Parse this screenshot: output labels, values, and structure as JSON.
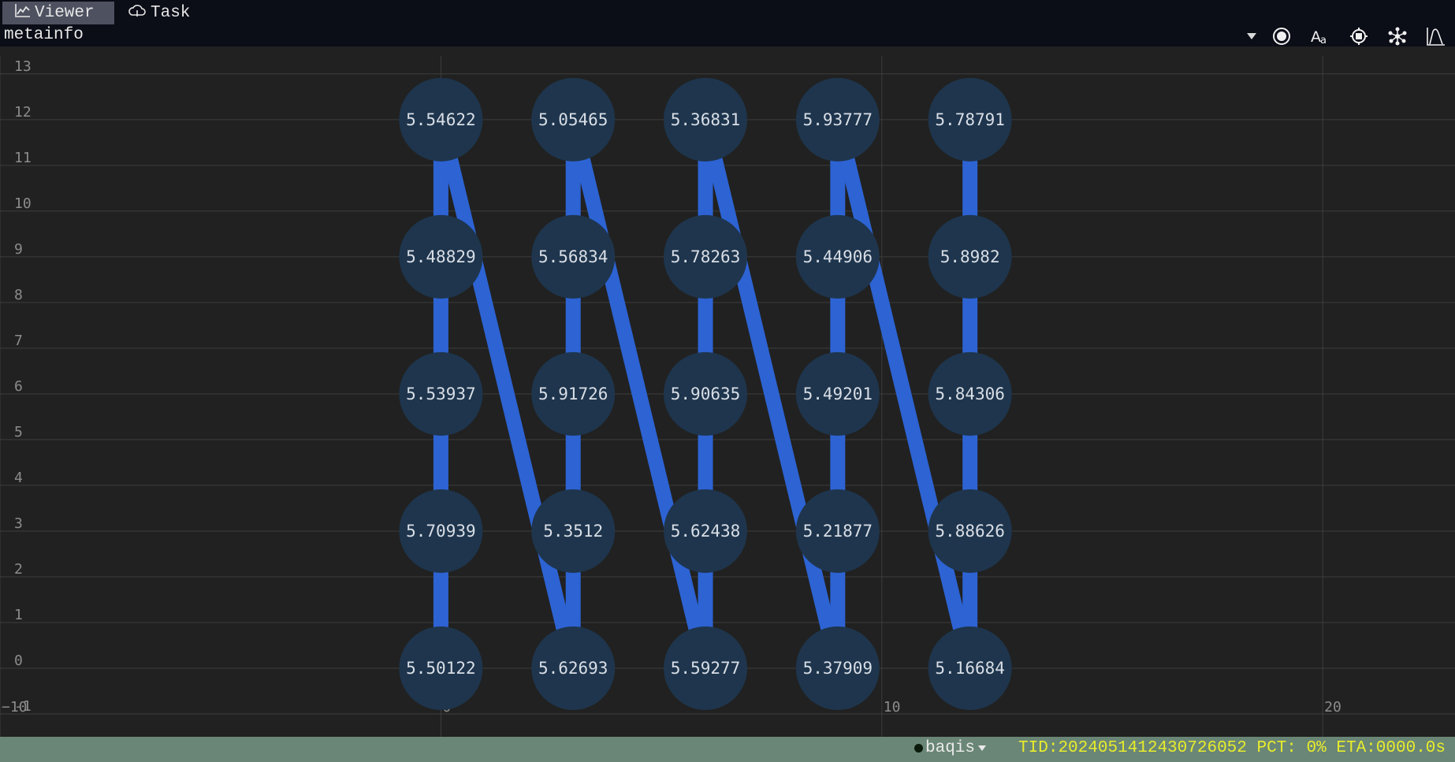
{
  "tabs": [
    {
      "label": "Viewer",
      "icon": "line-chart-icon",
      "active": true
    },
    {
      "label": "Task",
      "icon": "cloud-icon",
      "active": false
    }
  ],
  "metainfo": "metainfo",
  "toolbar_icons": [
    "dropdown-caret-icon",
    "target-icon",
    "font-size-icon",
    "chip-settings-icon",
    "network-icon",
    "histogram-icon"
  ],
  "status": {
    "user": "baqis",
    "tid_label": "TID:",
    "tid": "2024051412430726052",
    "pct_label": "PCT:",
    "pct": "0%",
    "eta_label": "ETA:",
    "eta": "0000.0s"
  },
  "colors": {
    "background": "#212121",
    "node_fill": "#1e354d",
    "edge": "#2d63d3",
    "status_bar": "#6a8676",
    "status_text": "#e8ec2c"
  },
  "chart_data": {
    "type": "scatter",
    "xlim": [
      -10,
      23
    ],
    "ylim": [
      -1.5,
      13.6
    ],
    "x_ticks": [
      -10,
      0,
      10,
      20
    ],
    "y_ticks": [
      -1,
      0,
      1,
      2,
      3,
      4,
      5,
      6,
      7,
      8,
      9,
      10,
      11,
      12,
      13
    ],
    "grid": true,
    "nodes": [
      {
        "x": 0,
        "y": 12,
        "label": "5.54622"
      },
      {
        "x": 3,
        "y": 12,
        "label": "5.05465"
      },
      {
        "x": 6,
        "y": 12,
        "label": "5.36831"
      },
      {
        "x": 9,
        "y": 12,
        "label": "5.93777"
      },
      {
        "x": 12,
        "y": 12,
        "label": "5.78791"
      },
      {
        "x": 0,
        "y": 9,
        "label": "5.48829"
      },
      {
        "x": 3,
        "y": 9,
        "label": "5.56834"
      },
      {
        "x": 6,
        "y": 9,
        "label": "5.78263"
      },
      {
        "x": 9,
        "y": 9,
        "label": "5.44906"
      },
      {
        "x": 12,
        "y": 9,
        "label": "5.8982"
      },
      {
        "x": 0,
        "y": 6,
        "label": "5.53937"
      },
      {
        "x": 3,
        "y": 6,
        "label": "5.91726"
      },
      {
        "x": 6,
        "y": 6,
        "label": "5.90635"
      },
      {
        "x": 9,
        "y": 6,
        "label": "5.49201"
      },
      {
        "x": 12,
        "y": 6,
        "label": "5.84306"
      },
      {
        "x": 0,
        "y": 3,
        "label": "5.70939"
      },
      {
        "x": 3,
        "y": 3,
        "label": "5.3512"
      },
      {
        "x": 6,
        "y": 3,
        "label": "5.62438"
      },
      {
        "x": 9,
        "y": 3,
        "label": "5.21877"
      },
      {
        "x": 12,
        "y": 3,
        "label": "5.88626"
      },
      {
        "x": 0,
        "y": 0,
        "label": "5.50122"
      },
      {
        "x": 3,
        "y": 0,
        "label": "5.62693"
      },
      {
        "x": 6,
        "y": 0,
        "label": "5.59277"
      },
      {
        "x": 9,
        "y": 0,
        "label": "5.37909"
      },
      {
        "x": 12,
        "y": 0,
        "label": "5.16684"
      }
    ],
    "edges": [
      [
        0,
        5
      ],
      [
        5,
        10
      ],
      [
        10,
        15
      ],
      [
        15,
        20
      ],
      [
        1,
        6
      ],
      [
        6,
        11
      ],
      [
        11,
        16
      ],
      [
        16,
        21
      ],
      [
        2,
        7
      ],
      [
        7,
        12
      ],
      [
        12,
        17
      ],
      [
        17,
        22
      ],
      [
        3,
        8
      ],
      [
        8,
        13
      ],
      [
        13,
        18
      ],
      [
        18,
        23
      ],
      [
        4,
        9
      ],
      [
        9,
        14
      ],
      [
        14,
        19
      ],
      [
        19,
        24
      ],
      [
        0,
        21
      ],
      [
        1,
        22
      ],
      [
        2,
        23
      ],
      [
        3,
        24
      ]
    ]
  }
}
